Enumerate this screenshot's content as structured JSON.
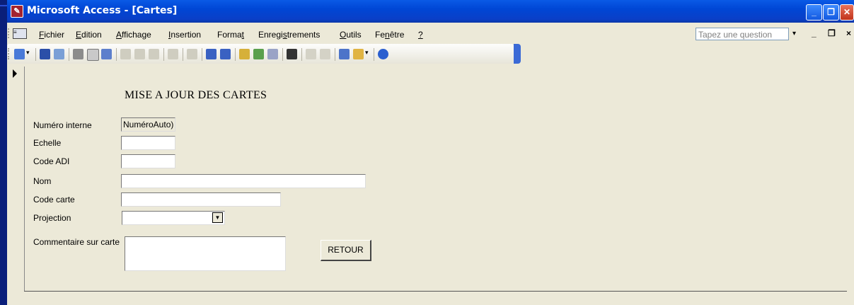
{
  "window": {
    "title": "Microsoft Access - [Cartes]"
  },
  "menu": {
    "items": [
      {
        "label": "Fichier",
        "underline": "F",
        "rest": "ichier"
      },
      {
        "label": "Edition",
        "underline": "E",
        "rest": "dition"
      },
      {
        "label": "Affichage",
        "underline": "A",
        "rest": "ffichage"
      },
      {
        "label": "Insertion",
        "underline": "I",
        "rest": "nsertion"
      },
      {
        "label": "Format",
        "pre": "Forma",
        "underline": "t",
        "rest": ""
      },
      {
        "label": "Enregistrements",
        "pre": "Enregi",
        "underline": "s",
        "rest": "trements"
      },
      {
        "label": "Outils",
        "underline": "O",
        "rest": "utils"
      },
      {
        "label": "Fenêtre",
        "pre": "Fe",
        "underline": "n",
        "rest": "être"
      },
      {
        "label": "?",
        "underline": "?",
        "rest": ""
      }
    ],
    "ask_placeholder": "Tapez une question"
  },
  "toolbar": {
    "icons": [
      "view-icon",
      "save-icon",
      "search-file-icon",
      "print-icon",
      "print-preview-icon",
      "spelling-icon",
      "cut-icon",
      "copy-icon",
      "paste-icon",
      "undo-icon",
      "hyperlink-icon",
      "sort-asc-icon",
      "sort-desc-icon",
      "filter-selection-icon",
      "filter-form-icon",
      "apply-filter-icon",
      "find-icon",
      "new-record-icon",
      "delete-record-icon",
      "database-window-icon",
      "new-object-icon",
      "help-icon"
    ],
    "colors": {
      "accent": "#3b6ad6"
    }
  },
  "form": {
    "title": "MISE A JOUR DES CARTES",
    "fields": {
      "numero_interne": {
        "label": "Numéro interne",
        "value": "NuméroAuto)"
      },
      "echelle": {
        "label": "Echelle",
        "value": ""
      },
      "code_adi": {
        "label": "Code ADI",
        "value": ""
      },
      "nom": {
        "label": "Nom",
        "value": ""
      },
      "code_carte": {
        "label": "Code carte",
        "value": ""
      },
      "projection": {
        "label": "Projection",
        "value": ""
      },
      "commentaire": {
        "label": "Commentaire sur carte",
        "value": ""
      }
    },
    "retour_label": "RETOUR"
  }
}
